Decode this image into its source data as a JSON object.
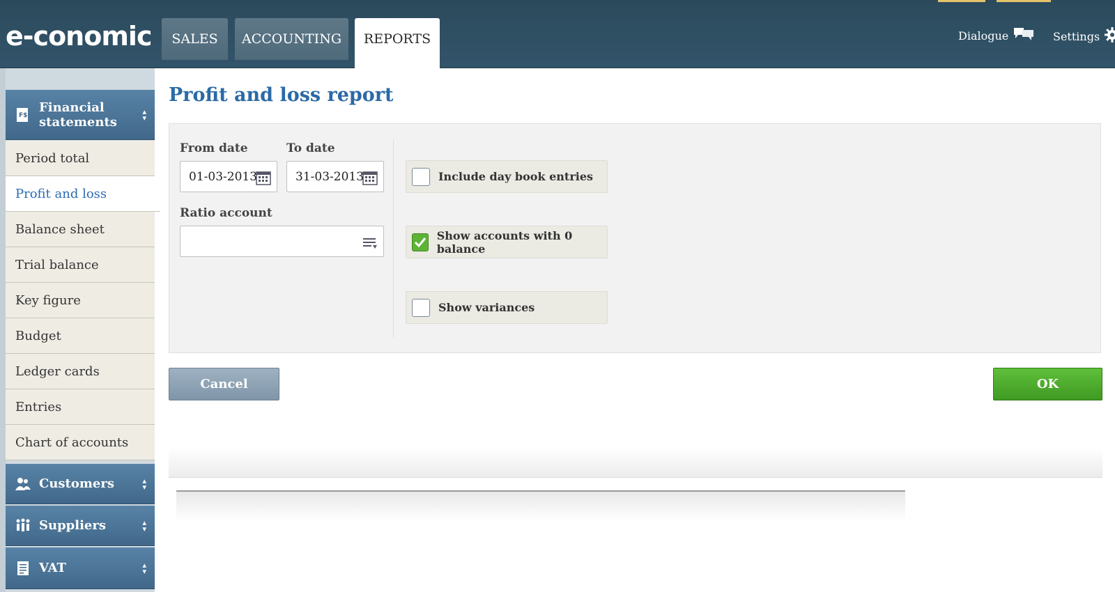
{
  "app": {
    "logo": "e-conomic"
  },
  "nav": {
    "tabs": [
      {
        "label": "SALES"
      },
      {
        "label": "ACCOUNTING"
      },
      {
        "label": "REPORTS"
      }
    ],
    "dialogue_label": "Dialogue",
    "settings_label": "Settings"
  },
  "sidebar": {
    "financial_statements": "Financial statements",
    "items": [
      {
        "label": "Period total"
      },
      {
        "label": "Profit and loss"
      },
      {
        "label": "Balance sheet"
      },
      {
        "label": "Trial balance"
      },
      {
        "label": "Key figure"
      },
      {
        "label": "Budget"
      },
      {
        "label": "Ledger cards"
      },
      {
        "label": "Entries"
      },
      {
        "label": "Chart of accounts"
      }
    ],
    "customers": "Customers",
    "suppliers": "Suppliers",
    "vat": "VAT"
  },
  "main": {
    "title": "Profit and loss report",
    "from_date_label": "From date",
    "from_date_value": "01-03-2013",
    "to_date_label": "To date",
    "to_date_value": "31-03-2013",
    "ratio_account_label": "Ratio account",
    "ratio_account_value": "",
    "options": [
      {
        "label": "Include day book entries",
        "checked": false
      },
      {
        "label": "Show accounts with 0 balance",
        "checked": true
      },
      {
        "label": "Show variances",
        "checked": false
      }
    ],
    "cancel_label": "Cancel",
    "ok_label": "OK"
  },
  "colors": {
    "topbar": "#2c4a5c",
    "accent_blue": "#2b6aa6",
    "ok_green": "#4faf2c",
    "cancel_gray": "#8fa3b5"
  }
}
